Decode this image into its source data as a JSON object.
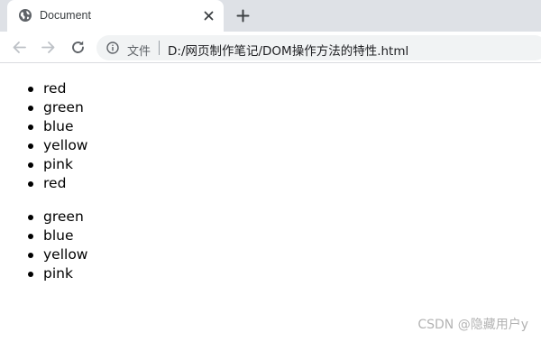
{
  "browser": {
    "tab": {
      "title": "Document",
      "favicon": "globe-icon",
      "close_icon": "close-icon"
    },
    "new_tab_icon": "plus-icon",
    "toolbar": {
      "back_icon": "arrow-left-icon",
      "forward_icon": "arrow-right-icon",
      "reload_icon": "reload-icon",
      "site_info_icon": "info-icon",
      "address_label": "文件",
      "url": "D:/网页制作笔记/DOM操作方法的特性.html"
    }
  },
  "page": {
    "list_1": [
      "red",
      "green",
      "blue",
      "yellow",
      "pink",
      "red"
    ],
    "list_2": [
      "green",
      "blue",
      "yellow",
      "pink"
    ]
  },
  "watermark": "CSDN @隐藏用户y",
  "colors": {
    "tab_strip": "#dee1e6",
    "omnibox": "#f1f3f4",
    "icon": "#5f6368"
  }
}
